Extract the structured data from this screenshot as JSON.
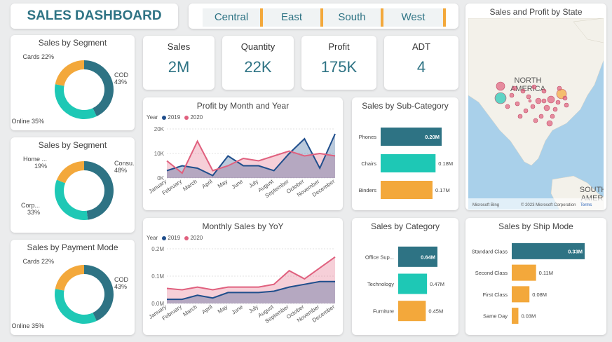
{
  "header": {
    "title": "SALES DASHBOARD"
  },
  "slicer": {
    "items": [
      "Central",
      "East",
      "South",
      "West"
    ]
  },
  "kpis": [
    {
      "label": "Sales",
      "value": "2M"
    },
    {
      "label": "Quantity",
      "value": "22K"
    },
    {
      "label": "Profit",
      "value": "175K"
    },
    {
      "label": "ADT",
      "value": "4"
    }
  ],
  "colors": {
    "teal": "#2e7384",
    "aqua": "#1ec8b5",
    "orange": "#f3a83b",
    "blue": "#1f4e8c",
    "pink": "#e0607e"
  },
  "map": {
    "title": "Sales and Profit by State",
    "labels": {
      "north_america": "NORTH\nAMERICA",
      "south_america": "SOUTH\nAMERI"
    },
    "footer_brand": "Microsoft Bing",
    "footer_copyright": "© 2023 Microsoft Corporation",
    "footer_terms": "Terms"
  },
  "chart_data": [
    {
      "id": "segment1",
      "type": "pie",
      "title": "Sales by Segment",
      "slices": [
        {
          "label": "COD",
          "pct": "43%",
          "value": 43,
          "color": "#2e7384"
        },
        {
          "label": "Online",
          "pct": "35%",
          "value": 35,
          "color": "#1ec8b5"
        },
        {
          "label": "Cards",
          "pct": "22%",
          "value": 22,
          "color": "#f3a83b"
        }
      ]
    },
    {
      "id": "segment2",
      "type": "pie",
      "title": "Sales by Segment",
      "slices": [
        {
          "label": "Consu...",
          "pct": "48%",
          "value": 48,
          "color": "#2e7384"
        },
        {
          "label": "Corp...",
          "pct": "33%",
          "value": 33,
          "color": "#1ec8b5"
        },
        {
          "label": "Home ...",
          "pct": "19%",
          "value": 19,
          "color": "#f3a83b"
        }
      ]
    },
    {
      "id": "payment",
      "type": "pie",
      "title": "Sales by Payment Mode",
      "slices": [
        {
          "label": "COD",
          "pct": "43%",
          "value": 43,
          "color": "#2e7384"
        },
        {
          "label": "Online",
          "pct": "35%",
          "value": 35,
          "color": "#1ec8b5"
        },
        {
          "label": "Cards",
          "pct": "22%",
          "value": 22,
          "color": "#f3a83b"
        }
      ]
    },
    {
      "id": "profit_month",
      "type": "area",
      "title": "Profit by Month and Year",
      "legend_title": "Year",
      "categories": [
        "January",
        "February",
        "March",
        "April",
        "May",
        "June",
        "July",
        "August",
        "September",
        "October",
        "November",
        "December"
      ],
      "yticks": [
        "0K",
        "10K",
        "20K"
      ],
      "ylim": [
        0,
        20000
      ],
      "series": [
        {
          "name": "2019",
          "color": "#1f4e8c",
          "values": [
            3000,
            5000,
            4000,
            1000,
            9000,
            5000,
            5000,
            3000,
            10000,
            16000,
            4000,
            18000
          ]
        },
        {
          "name": "2020",
          "color": "#e0607e",
          "values": [
            7000,
            2000,
            15000,
            3000,
            5000,
            8000,
            7000,
            9000,
            11000,
            9000,
            10000,
            9000
          ]
        }
      ]
    },
    {
      "id": "monthly_sales",
      "type": "area",
      "title": "Monthly Sales by YoY",
      "legend_title": "Year",
      "categories": [
        "January",
        "February",
        "March",
        "April",
        "May",
        "June",
        "July",
        "August",
        "September",
        "October",
        "November",
        "December"
      ],
      "yticks": [
        "0.0M",
        "0.1M",
        "0.2M"
      ],
      "ylim": [
        0,
        200000
      ],
      "series": [
        {
          "name": "2019",
          "color": "#1f4e8c",
          "values": [
            15000,
            15000,
            30000,
            20000,
            40000,
            40000,
            40000,
            45000,
            60000,
            70000,
            80000,
            80000
          ]
        },
        {
          "name": "2020",
          "color": "#e0607e",
          "values": [
            55000,
            50000,
            60000,
            50000,
            60000,
            60000,
            60000,
            70000,
            120000,
            90000,
            130000,
            170000
          ]
        }
      ]
    },
    {
      "id": "subcat",
      "type": "bar",
      "title": "Sales by Sub-Category",
      "categories": [
        "Phones",
        "Chairs",
        "Binders"
      ],
      "values": [
        0.2,
        0.18,
        0.17
      ],
      "labels": [
        "0.20M",
        "0.18M",
        "0.17M"
      ],
      "colors": [
        "#2e7384",
        "#1ec8b5",
        "#f3a83b"
      ]
    },
    {
      "id": "category",
      "type": "bar",
      "title": "Sales by Category",
      "categories": [
        "Office Sup...",
        "Technology",
        "Furniture"
      ],
      "values": [
        0.64,
        0.47,
        0.45
      ],
      "labels": [
        "0.64M",
        "0.47M",
        "0.45M"
      ],
      "colors": [
        "#2e7384",
        "#1ec8b5",
        "#f3a83b"
      ]
    },
    {
      "id": "shipmode",
      "type": "bar",
      "title": "Sales by Ship Mode",
      "categories": [
        "Standard Class",
        "Second Class",
        "First Class",
        "Same Day"
      ],
      "values": [
        0.33,
        0.11,
        0.08,
        0.03
      ],
      "labels": [
        "0.33M",
        "0.11M",
        "0.08M",
        "0.03M"
      ],
      "colors": [
        "#2e7384",
        "#f3a83b",
        "#f3a83b",
        "#f3a83b"
      ]
    }
  ]
}
